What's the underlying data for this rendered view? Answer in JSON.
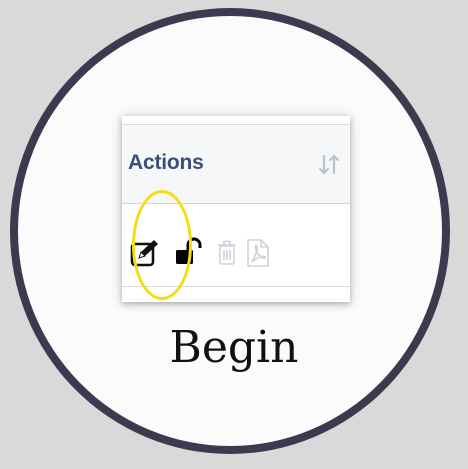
{
  "screenshot": {
    "column_header": "Actions",
    "icons": {
      "sort": "sort-icon",
      "edit": "edit-icon",
      "lock": "unlock-icon",
      "delete": "trash-icon",
      "pdf": "pdf-icon"
    }
  },
  "caption": "Begin",
  "colors": {
    "ring": "#3b3a4e",
    "highlight": "#f4dd16",
    "header_text": "#3a4e78"
  }
}
